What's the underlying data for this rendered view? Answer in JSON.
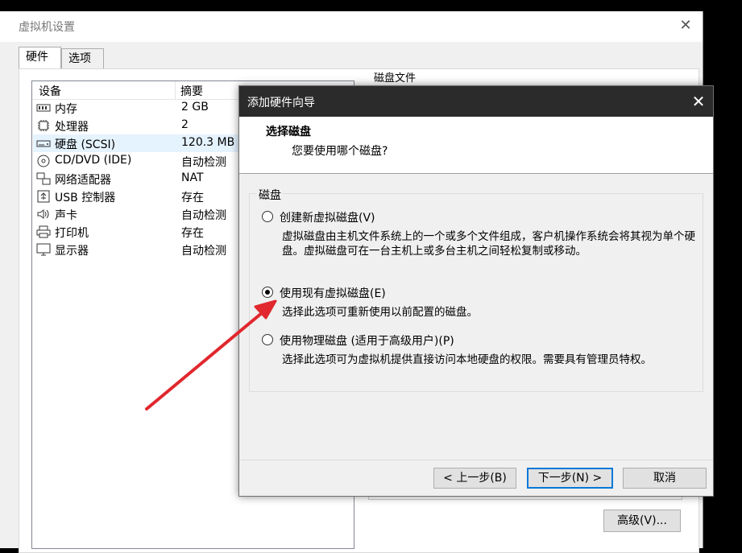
{
  "window": {
    "title": "虚拟机设置",
    "close_glyph": "✕",
    "tabs": [
      {
        "label": "硬件"
      },
      {
        "label": "选项"
      }
    ],
    "columns": {
      "device": "设备",
      "summary": "摘要"
    },
    "devices": [
      {
        "name": "内存",
        "summary": "2 GB",
        "icon": "memory-icon"
      },
      {
        "name": "处理器",
        "summary": "2",
        "icon": "processor-icon"
      },
      {
        "name": "硬盘 (SCSI)",
        "summary": "120.3 MB",
        "icon": "hard-disk-icon"
      },
      {
        "name": "CD/DVD (IDE)",
        "summary": "自动检测",
        "icon": "cd-dvd-icon"
      },
      {
        "name": "网络适配器",
        "summary": "NAT",
        "icon": "network-adapter-icon"
      },
      {
        "name": "USB 控制器",
        "summary": "存在",
        "icon": "usb-icon"
      },
      {
        "name": "声卡",
        "summary": "自动检测",
        "icon": "sound-card-icon"
      },
      {
        "name": "打印机",
        "summary": "存在",
        "icon": "printer-icon"
      },
      {
        "name": "显示器",
        "summary": "自动检测",
        "icon": "display-icon"
      }
    ],
    "selected_device": "硬盘 (SCSI)",
    "right_panel_peek": "磁盘文件",
    "advanced_label": "高级(V)..."
  },
  "wizard": {
    "title": "添加硬件向导",
    "close_glyph": "✕",
    "heading": "选择磁盘",
    "subheading": "您要使用哪个磁盘?",
    "group_label": "磁盘",
    "options": [
      {
        "label": "创建新虚拟磁盘(V)",
        "description": "虚拟磁盘由主机文件系统上的一个或多个文件组成，客户机操作系统会将其视为单个硬盘。虚拟磁盘可在一台主机上或多台主机之间轻松复制或移动。",
        "checked": false
      },
      {
        "label": "使用现有虚拟磁盘(E)",
        "description": "选择此选项可重新使用以前配置的磁盘。",
        "checked": true
      },
      {
        "label": "使用物理磁盘 (适用于高级用户)(P)",
        "description": "选择此选项可为虚拟机提供直接访问本地硬盘的权限。需要具有管理员特权。",
        "checked": false
      }
    ],
    "buttons": {
      "back": "< 上一步(B)",
      "next": "下一步(N) >",
      "cancel": "取消"
    }
  },
  "colors": {
    "annotation_arrow": "#e0282e",
    "selection": "#e5f3ff",
    "default_button_border": "#0078d7"
  }
}
